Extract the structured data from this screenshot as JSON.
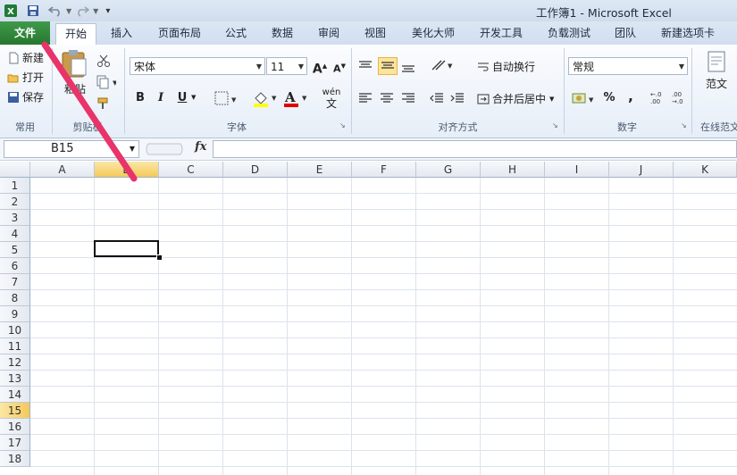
{
  "window": {
    "title": "工作簿1 - Microsoft Excel"
  },
  "quick_access": {
    "icons": [
      "excel-logo-icon",
      "save-icon",
      "undo-icon",
      "redo-icon",
      "customize-icon"
    ]
  },
  "tabs": [
    {
      "label": "文件",
      "kind": "file"
    },
    {
      "label": "开始",
      "kind": "active"
    },
    {
      "label": "插入"
    },
    {
      "label": "页面布局"
    },
    {
      "label": "公式"
    },
    {
      "label": "数据"
    },
    {
      "label": "审阅"
    },
    {
      "label": "视图"
    },
    {
      "label": "美化大师"
    },
    {
      "label": "开发工具"
    },
    {
      "label": "负载测试"
    },
    {
      "label": "团队"
    },
    {
      "label": "新建选项卡"
    }
  ],
  "ribbon": {
    "common": {
      "new": "新建",
      "open": "打开",
      "save": "保存",
      "label": "常用"
    },
    "clipboard": {
      "paste": "粘贴",
      "label": "剪贴板"
    },
    "font": {
      "name": "宋体",
      "size": "11",
      "bold": "B",
      "italic": "I",
      "underline": "U",
      "label": "字体",
      "grow": "A",
      "shrink": "A",
      "color_letter": "A",
      "wen": "wén"
    },
    "align": {
      "wrap": "自动换行",
      "merge": "合并后居中",
      "label": "对齐方式"
    },
    "number": {
      "format": "常规",
      "percent": "%",
      "comma": ",",
      "label": "数字"
    },
    "template": {
      "btn": "范文",
      "label": "在线范文"
    }
  },
  "formula_bar": {
    "name_box": "B15",
    "fx": "fx",
    "value": ""
  },
  "sheet": {
    "columns": [
      "A",
      "B",
      "C",
      "D",
      "E",
      "F",
      "G",
      "H",
      "I",
      "J",
      "K"
    ],
    "rows": [
      "1",
      "2",
      "3",
      "4",
      "5",
      "6",
      "7",
      "8",
      "9",
      "10",
      "11",
      "12",
      "13",
      "14",
      "15",
      "16",
      "17",
      "18"
    ],
    "selected_col": "B",
    "selected_row": "15"
  },
  "colors": {
    "file_tab": "#2e8b3a",
    "accent_highlight": "#f4c95a",
    "annotation_arrow": "#e8336b"
  }
}
